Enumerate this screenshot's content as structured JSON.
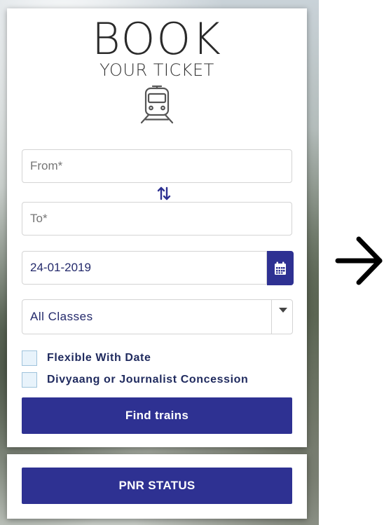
{
  "header": {
    "title": "BOOK",
    "subtitle": "YOUR TICKET",
    "icon": "train-icon"
  },
  "form": {
    "from_placeholder": "From*",
    "to_placeholder": "To*",
    "swap_icon": "swap-icon",
    "date_value": "24-01-2019",
    "calendar_icon": "calendar-icon",
    "class_selected": "All Classes",
    "checkboxes": [
      {
        "label": "Flexible With Date",
        "checked": false
      },
      {
        "label": "Divyaang or Journalist Concession",
        "checked": false
      }
    ],
    "submit_label": "Find trains"
  },
  "pnr": {
    "button_label": "PNR STATUS"
  },
  "side": {
    "arrow_icon": "right-arrow-icon"
  },
  "colors": {
    "primary": "#2e3192",
    "text_dark": "#23296b",
    "placeholder": "#8a8a8a"
  }
}
